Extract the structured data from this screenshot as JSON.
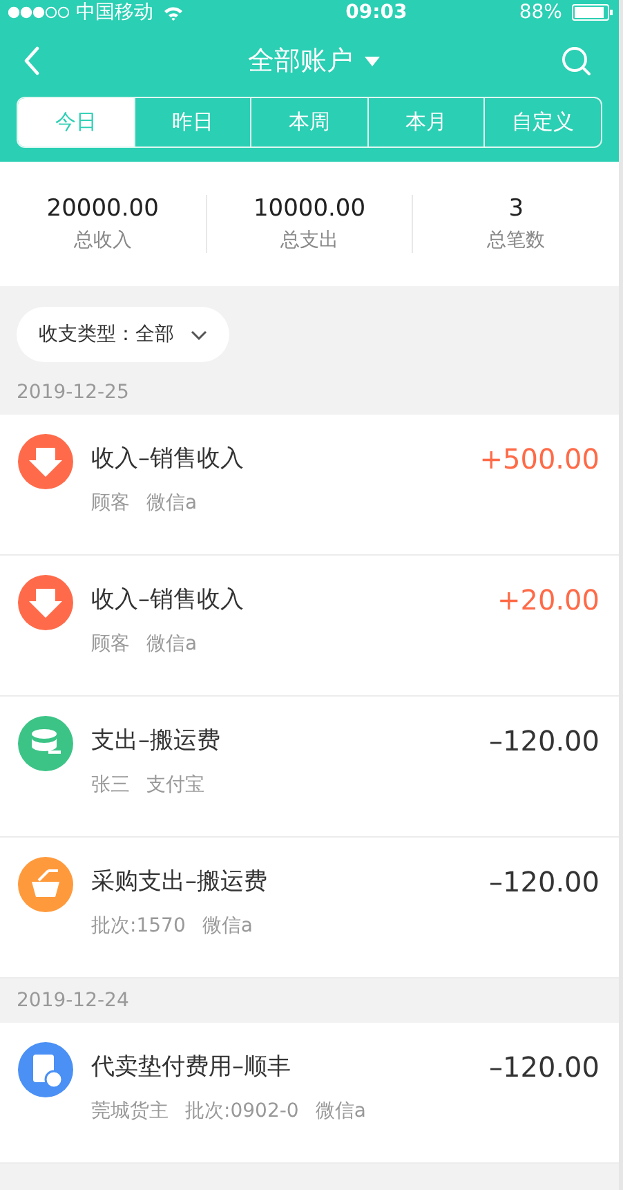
{
  "status_bar": {
    "carrier": "中国移动",
    "time": "09:03",
    "battery": "88%"
  },
  "header": {
    "title": "全部账户"
  },
  "tabs": [
    {
      "label": "今日",
      "selected": true
    },
    {
      "label": "昨日",
      "selected": false
    },
    {
      "label": "本周",
      "selected": false
    },
    {
      "label": "本月",
      "selected": false
    },
    {
      "label": "自定义",
      "selected": false
    }
  ],
  "summary": [
    {
      "value": "20000.00",
      "label": "总收入"
    },
    {
      "value": "10000.00",
      "label": "总支出"
    },
    {
      "value": "3",
      "label": "总笔数"
    }
  ],
  "filter": {
    "label": "收支类型：全部"
  },
  "groups": [
    {
      "date": "2019-12-25",
      "items": [
        {
          "kind": "income",
          "title": "收入–销售收入",
          "amount": "+500.00",
          "meta": [
            "顾客",
            "微信a"
          ]
        },
        {
          "kind": "income",
          "title": "收入–销售收入",
          "amount": "+20.00",
          "meta": [
            "顾客",
            "微信a"
          ]
        },
        {
          "kind": "expense",
          "title": "支出–搬运费",
          "amount": "–120.00",
          "meta": [
            "张三",
            "支付宝"
          ]
        },
        {
          "kind": "purchase",
          "title": "采购支出–搬运费",
          "amount": "–120.00",
          "meta": [
            "批次:1570",
            "微信a"
          ]
        }
      ]
    },
    {
      "date": "2019-12-24",
      "items": [
        {
          "kind": "advance",
          "title": "代卖垫付费用–顺丰",
          "amount": "–120.00",
          "meta": [
            "莞城货主",
            "批次:0902-0",
            "微信a"
          ]
        }
      ]
    }
  ]
}
